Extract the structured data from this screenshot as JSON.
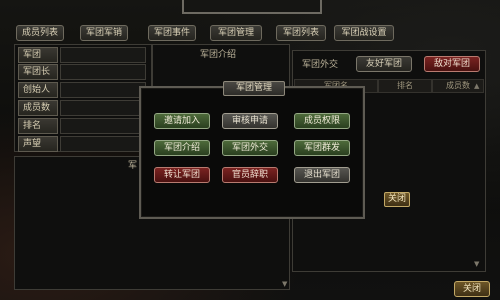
{
  "tabs": [
    "成员列表",
    "军团军销",
    "军团事件",
    "军团管理",
    "军团列表",
    "军团战设置"
  ],
  "left_info": {
    "fields": [
      "军团",
      "军团长",
      "创始人",
      "成员数",
      "排名",
      "声望"
    ]
  },
  "intro_panel": {
    "title": "军团介绍"
  },
  "lower_panel": {
    "title": "军"
  },
  "diplomacy": {
    "title": "军团外交",
    "friendly_button": "友好军团",
    "hostile_button": "敌对军团",
    "columns": [
      "军团名",
      "排名",
      "成员数"
    ]
  },
  "modal": {
    "title": "军团管理",
    "buttons": [
      {
        "label": "邀请加入",
        "style": "green"
      },
      {
        "label": "审核申请",
        "style": "gray"
      },
      {
        "label": "成员权限",
        "style": "green"
      },
      {
        "label": "军团介绍",
        "style": "green"
      },
      {
        "label": "军团外交",
        "style": "green"
      },
      {
        "label": "军团群发",
        "style": "green"
      },
      {
        "label": "转让军团",
        "style": "red"
      },
      {
        "label": "官员辞职",
        "style": "red"
      },
      {
        "label": "退出军团",
        "style": "gray"
      }
    ],
    "close_label": "关闭"
  },
  "footer": {
    "close_label": "关闭"
  }
}
